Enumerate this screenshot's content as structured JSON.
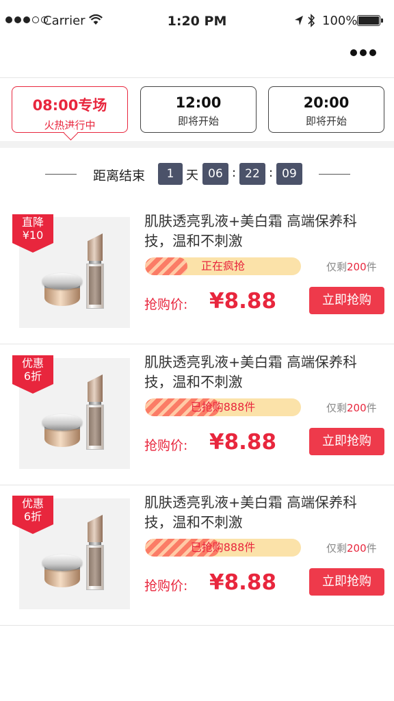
{
  "status_bar": {
    "carrier": "Carrier",
    "time": "1:20 PM",
    "battery": "100%"
  },
  "sessions": [
    {
      "time": "08:00专场",
      "status": "火热进行中",
      "active": true
    },
    {
      "time": "12:00",
      "status": "即将开始",
      "active": false
    },
    {
      "time": "20:00",
      "status": "即将开始",
      "active": false
    }
  ],
  "countdown": {
    "label": "距离结束",
    "days": "1",
    "days_unit": "天",
    "hours": "06",
    "minutes": "22",
    "seconds": "09",
    "separator": ":"
  },
  "products": [
    {
      "badge_line1": "直降",
      "badge_line2": "¥10",
      "title": "肌肤透亮乳液+美白霜 高端保养科技，温和不刺激",
      "progress_text": "正在疯抢",
      "progress": 0.27,
      "stock_prefix": "仅剩",
      "stock_num": "200",
      "stock_suffix": "件",
      "price_label": "抢购价:",
      "price": "¥8.88",
      "buy_label": "立即抢购"
    },
    {
      "badge_line1": "优惠",
      "badge_line2": "6折",
      "title": "肌肤透亮乳液+美白霜 高端保养科技，温和不刺激",
      "progress_text": "已抢购888件",
      "progress": 0.48,
      "stock_prefix": "仅剩",
      "stock_num": "200",
      "stock_suffix": "件",
      "price_label": "抢购价:",
      "price": "¥8.88",
      "buy_label": "立即抢购"
    },
    {
      "badge_line1": "优惠",
      "badge_line2": "6折",
      "title": "肌肤透亮乳液+美白霜 高端保养科技，温和不刺激",
      "progress_text": "已抢购888件",
      "progress": 0.48,
      "stock_prefix": "仅剩",
      "stock_num": "200",
      "stock_suffix": "件",
      "price_label": "抢购价:",
      "price": "¥8.88",
      "buy_label": "立即抢购"
    }
  ],
  "colors": {
    "accent": "#e8263d",
    "countdown_box": "#4b5269",
    "progress_track": "#fbe2a9"
  },
  "icons": {
    "wifi": "wifi-icon",
    "location": "location-arrow-icon",
    "bluetooth": "bluetooth-icon",
    "more": "more-dots-icon"
  }
}
